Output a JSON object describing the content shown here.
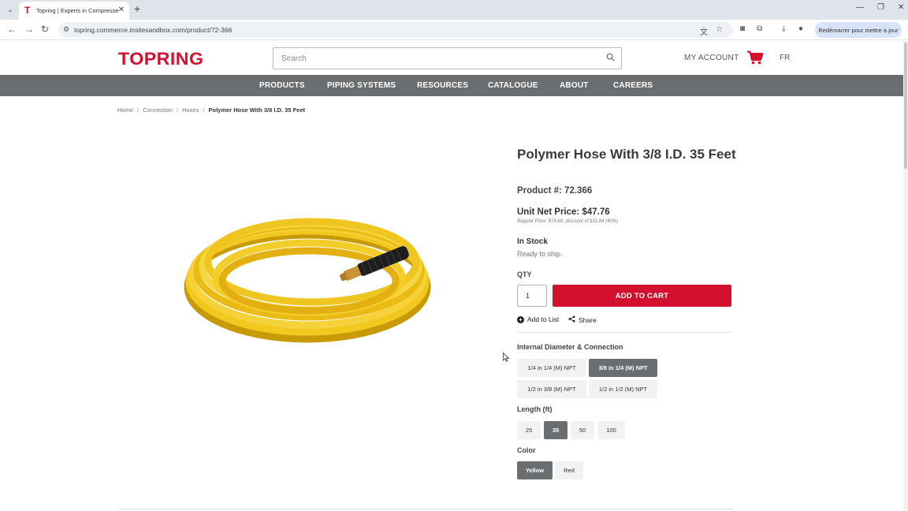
{
  "browser": {
    "tab_title": "Topring | Experts in Compresse",
    "url": "topring.commerce.insitesandbox.com/product/72-366",
    "relaunch_label": "Redémarrer pour mettre à jour"
  },
  "header": {
    "logo": "TOPRING",
    "search_placeholder": "Search",
    "my_account": "MY ACCOUNT",
    "language": "FR"
  },
  "nav": {
    "items": [
      "PRODUCTS",
      "PIPING SYSTEMS",
      "RESOURCES",
      "CATALOGUE",
      "ABOUT",
      "CAREERS"
    ]
  },
  "breadcrumb": [
    "Home",
    "Connection",
    "Hoses",
    "Polymer Hose With 3/8 I.D. 35 Feet"
  ],
  "product": {
    "title": "Polymer Hose With 3/8 I.D. 35 Feet",
    "product_number": "Product #: 72.366",
    "unit_price": "Unit Net Price: $47.76",
    "regular_price": "Regular Price: $79.60, discount of $31.84 (40%)",
    "stock": "In Stock",
    "ready": "Ready to ship.",
    "qty_label": "QTY",
    "qty_value": "1",
    "add_to_cart": "ADD TO CART",
    "add_to_list": "Add to List",
    "share": "Share"
  },
  "options": {
    "diameter_label": "Internal Diameter & Connection",
    "diameter": [
      "1/4 in 1/4 (M) NPT",
      "3/8 in 1/4 (M) NPT",
      "1/2 in 3/8 (M) NPT",
      "1/2 in 1/2 (M) NPT"
    ],
    "diameter_selected": "3/8 in 1/4 (M) NPT",
    "length_label": "Length (ft)",
    "length": [
      "25",
      "35",
      "50",
      "100"
    ],
    "length_selected": "35",
    "color_label": "Color",
    "color": [
      "Yellow",
      "Red"
    ],
    "color_selected": "Yellow"
  },
  "colors": {
    "brand_red": "#d3102d",
    "nav_gray": "#6b6e70",
    "hose_yellow": "#f2c81e"
  }
}
